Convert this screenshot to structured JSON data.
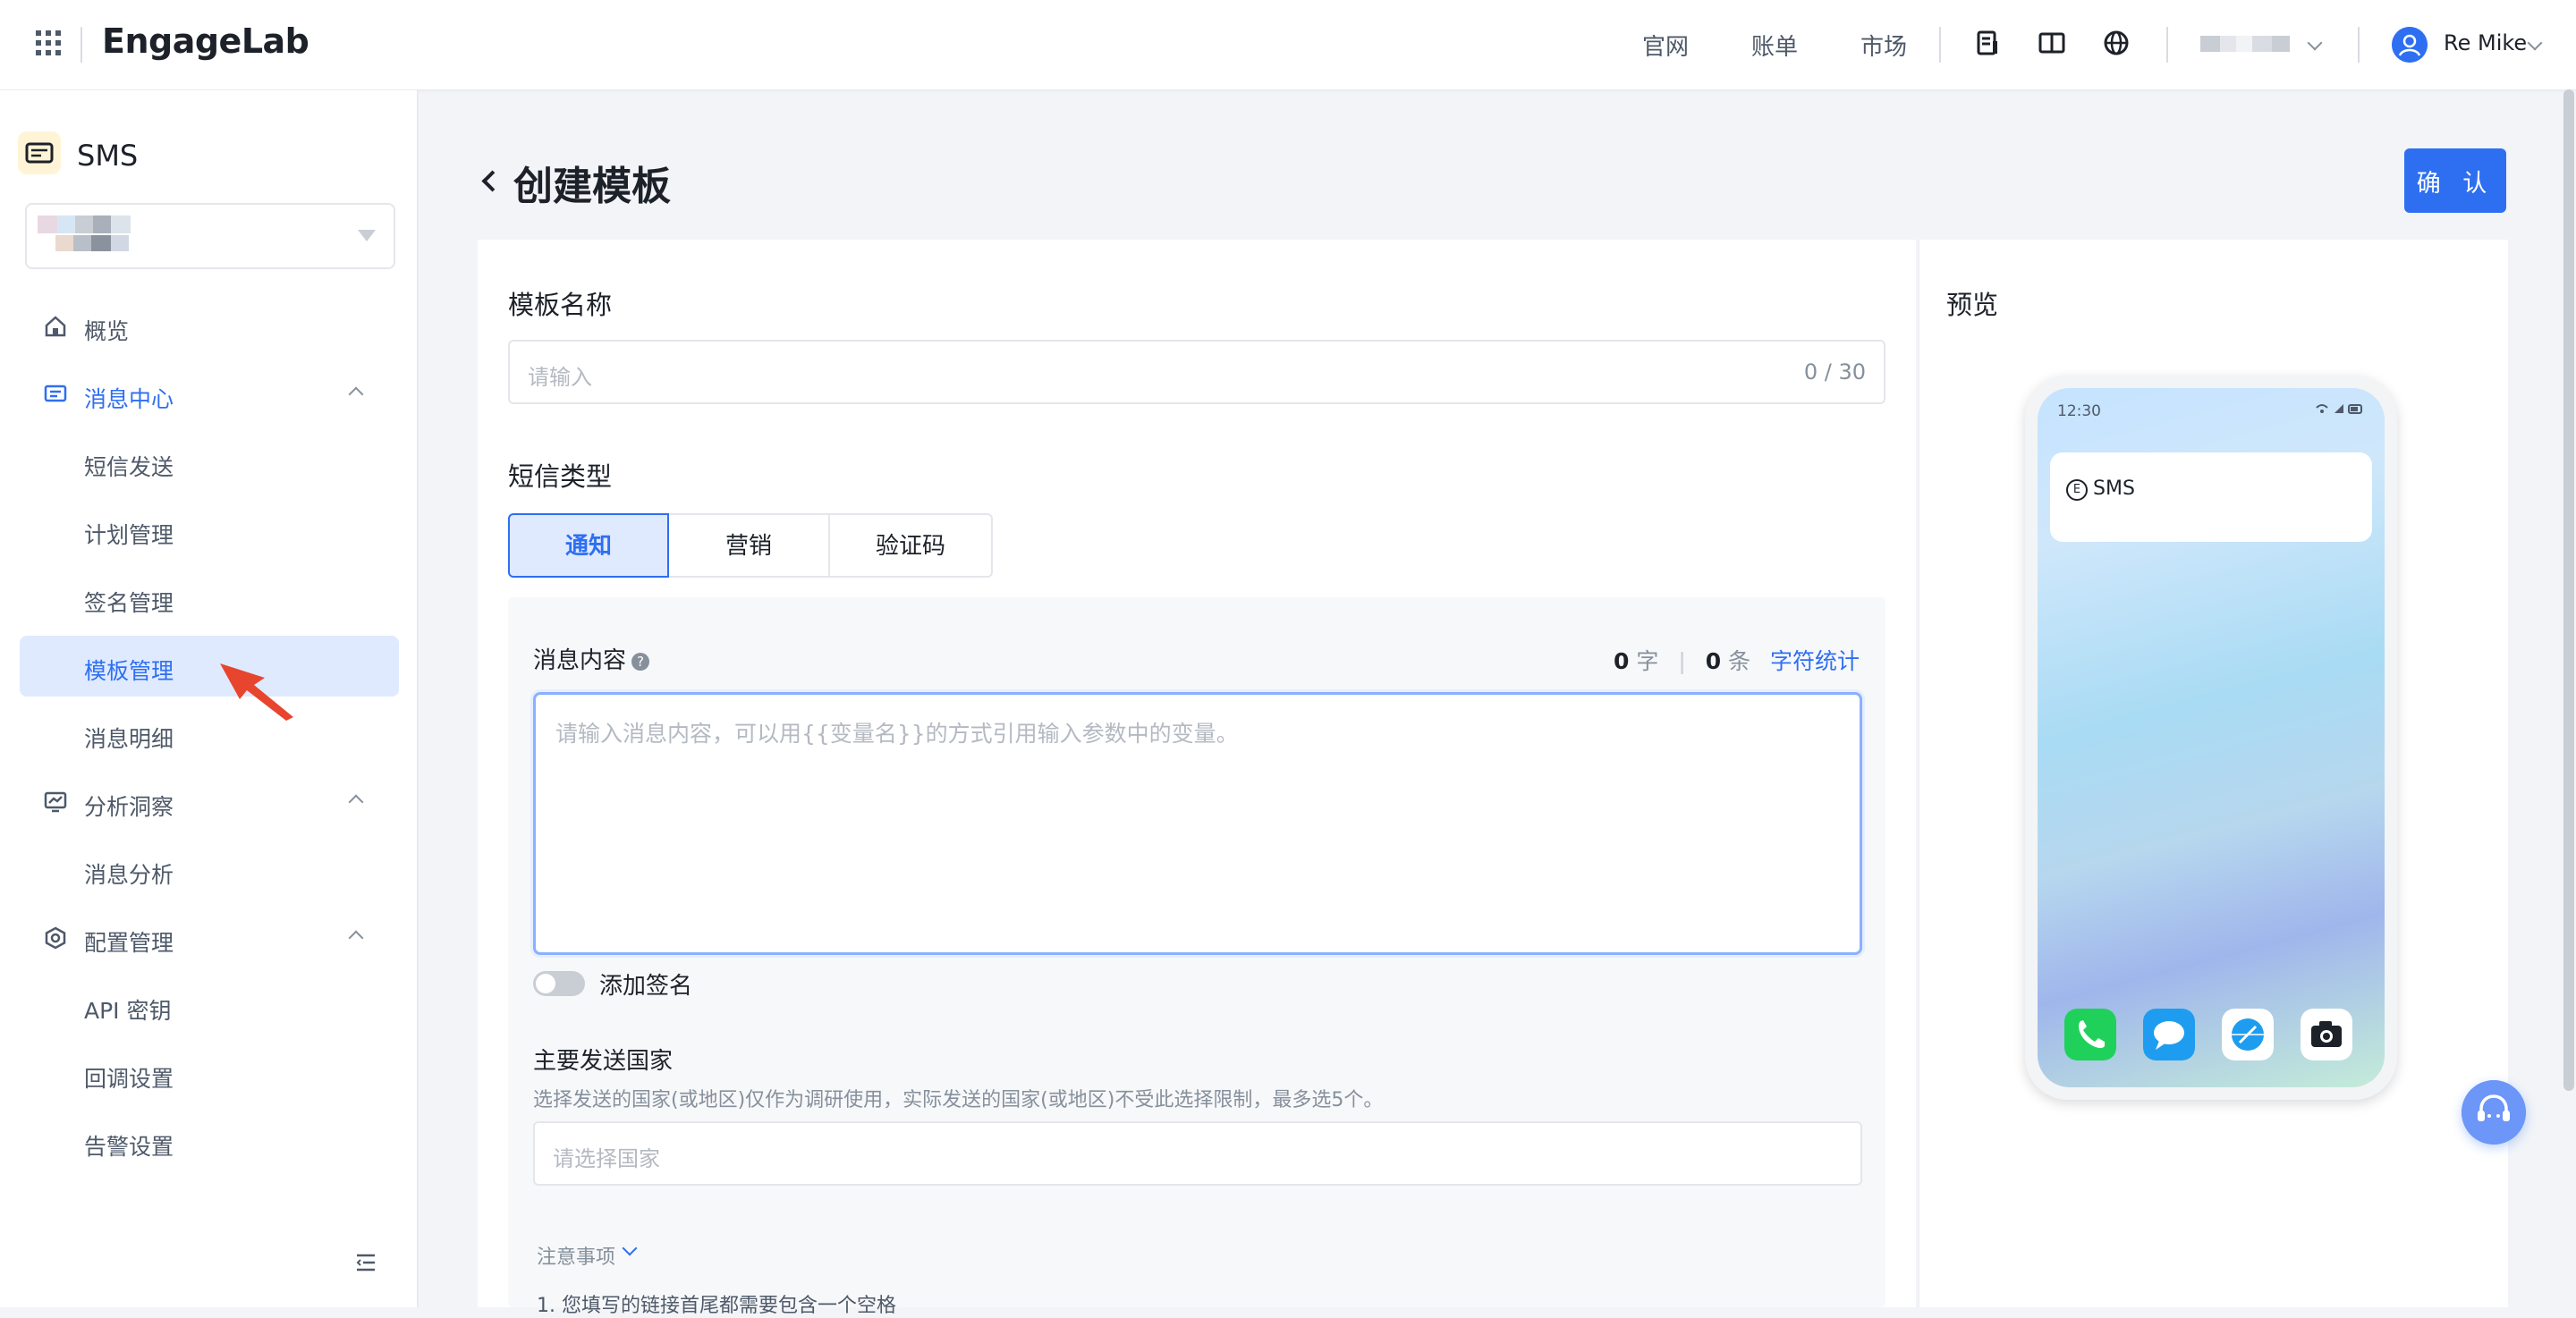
{
  "topbar": {
    "logo": "EngageLab",
    "links": [
      "官网",
      "账单",
      "市场"
    ],
    "username": "Re Mike"
  },
  "sidebar": {
    "product": "SMS",
    "nav": {
      "overview": "概览",
      "message_center": "消息中心",
      "sms_send": "短信发送",
      "plan_mgmt": "计划管理",
      "signature_mgmt": "签名管理",
      "template_mgmt": "模板管理",
      "message_detail": "消息明细",
      "analytics": "分析洞察",
      "message_analysis": "消息分析",
      "config_mgmt": "配置管理",
      "api_key": "API 密钥",
      "callback_settings": "回调设置",
      "alert_settings": "告警设置"
    }
  },
  "page": {
    "title": "创建模板",
    "confirm_label": "确 认"
  },
  "form": {
    "template_name_label": "模板名称",
    "template_name_placeholder": "请输入",
    "template_name_counter": "0 / 30",
    "sms_type_label": "短信类型",
    "sms_types": [
      "通知",
      "营销",
      "验证码"
    ],
    "selected_type": "通知",
    "content_label": "消息内容",
    "char_count": "0",
    "char_unit": "字",
    "stat_sep": "|",
    "msg_count": "0",
    "msg_unit": "条",
    "char_stats_link": "字符统计",
    "content_placeholder": "请输入消息内容，可以用{{变量名}}的方式引用输入参数中的变量。",
    "add_signature_label": "添加签名",
    "add_signature_on": false,
    "country_label": "主要发送国家",
    "country_hint": "选择发送的国家(或地区)仅作为调研使用，实际发送的国家(或地区)不受此选择限制，最多选5个。",
    "country_placeholder": "请选择国家",
    "notes_label": "注意事项",
    "note_1": "1. 您填写的链接首尾都需要包含一个空格"
  },
  "preview": {
    "label": "预览",
    "time": "12:30",
    "notification_badge": "E",
    "notification_app": "SMS",
    "dock_icons": [
      "phone-icon",
      "messages-icon",
      "browser-icon",
      "camera-icon"
    ]
  },
  "colors": {
    "accent": "#2e6ff2",
    "active_bg": "#dfeaff",
    "page_bg": "#f2f4f7"
  }
}
